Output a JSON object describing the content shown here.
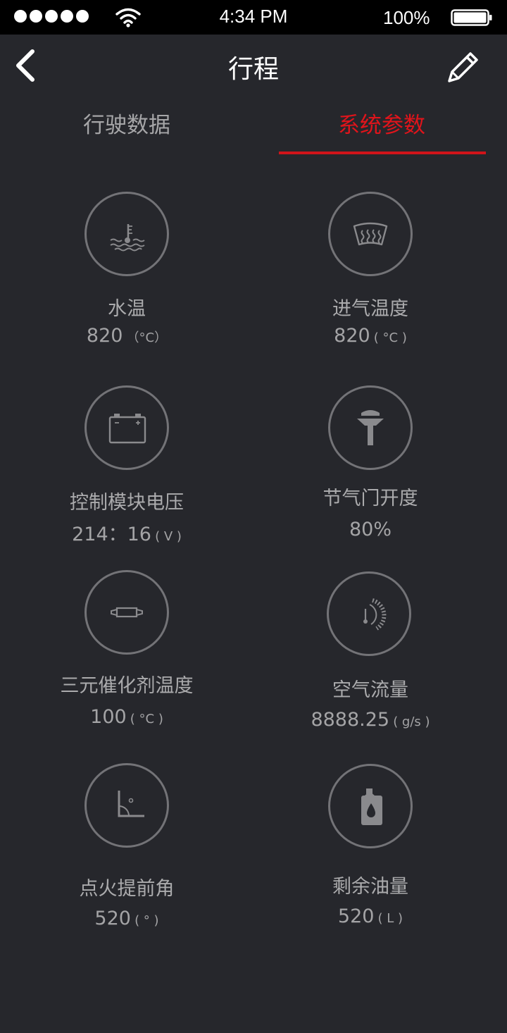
{
  "status_bar": {
    "time": "4:34 PM",
    "battery": "100%",
    "icons": [
      "signal-dots",
      "wifi-icon",
      "battery-icon"
    ]
  },
  "nav": {
    "title": "行程",
    "back_icon": "chevron-left-icon",
    "edit_icon": "pencil-icon"
  },
  "tabs": [
    {
      "label": "行驶数据",
      "active": false
    },
    {
      "label": "系统参数",
      "active": true
    }
  ],
  "colors": {
    "background": "#26272c",
    "accent": "#d0141a",
    "icon_stroke": "#737377",
    "text": "#ababad"
  },
  "params": [
    {
      "label": "水温",
      "value": "820",
      "unit": "（°C）",
      "icon": "coolant-temperature-icon"
    },
    {
      "label": "进气温度",
      "value": "820",
      "unit": "( °C )",
      "icon": "defrost-intake-icon"
    },
    {
      "label": "控制模块电压",
      "value": "214：16",
      "unit": "( V )",
      "icon": "battery-voltage-icon"
    },
    {
      "label": "节气门开度",
      "value": "80%",
      "unit": "",
      "icon": "throttle-icon"
    },
    {
      "label": "三元催化剂温度",
      "value": "100",
      "unit": "( °C )",
      "icon": "catalyst-icon"
    },
    {
      "label": "空气流量",
      "value": "8888.25",
      "unit": "( g/s )",
      "icon": "airflow-gauge-icon"
    },
    {
      "label": "点火提前角",
      "value": "520",
      "unit": "( ° )",
      "icon": "ignition-angle-icon"
    },
    {
      "label": "剩余油量",
      "value": "520",
      "unit": "( L )",
      "icon": "oil-can-icon"
    }
  ]
}
